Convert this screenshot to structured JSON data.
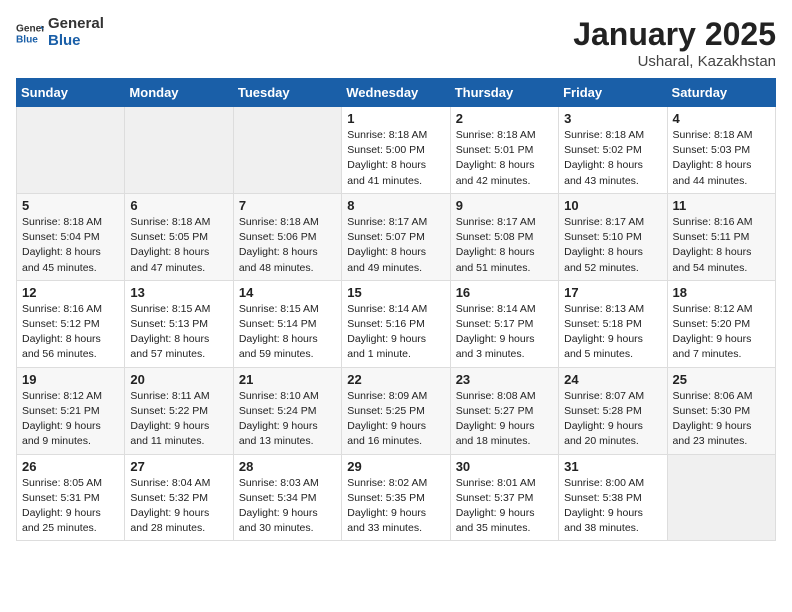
{
  "logo": {
    "general": "General",
    "blue": "Blue"
  },
  "header": {
    "month": "January 2025",
    "location": "Usharal, Kazakhstan"
  },
  "days_of_week": [
    "Sunday",
    "Monday",
    "Tuesday",
    "Wednesday",
    "Thursday",
    "Friday",
    "Saturday"
  ],
  "weeks": [
    [
      {
        "day": "",
        "empty": true
      },
      {
        "day": "",
        "empty": true
      },
      {
        "day": "",
        "empty": true
      },
      {
        "day": "1",
        "sunrise": "8:18 AM",
        "sunset": "5:00 PM",
        "daylight": "8 hours and 41 minutes."
      },
      {
        "day": "2",
        "sunrise": "8:18 AM",
        "sunset": "5:01 PM",
        "daylight": "8 hours and 42 minutes."
      },
      {
        "day": "3",
        "sunrise": "8:18 AM",
        "sunset": "5:02 PM",
        "daylight": "8 hours and 43 minutes."
      },
      {
        "day": "4",
        "sunrise": "8:18 AM",
        "sunset": "5:03 PM",
        "daylight": "8 hours and 44 minutes."
      }
    ],
    [
      {
        "day": "5",
        "sunrise": "8:18 AM",
        "sunset": "5:04 PM",
        "daylight": "8 hours and 45 minutes."
      },
      {
        "day": "6",
        "sunrise": "8:18 AM",
        "sunset": "5:05 PM",
        "daylight": "8 hours and 47 minutes."
      },
      {
        "day": "7",
        "sunrise": "8:18 AM",
        "sunset": "5:06 PM",
        "daylight": "8 hours and 48 minutes."
      },
      {
        "day": "8",
        "sunrise": "8:17 AM",
        "sunset": "5:07 PM",
        "daylight": "8 hours and 49 minutes."
      },
      {
        "day": "9",
        "sunrise": "8:17 AM",
        "sunset": "5:08 PM",
        "daylight": "8 hours and 51 minutes."
      },
      {
        "day": "10",
        "sunrise": "8:17 AM",
        "sunset": "5:10 PM",
        "daylight": "8 hours and 52 minutes."
      },
      {
        "day": "11",
        "sunrise": "8:16 AM",
        "sunset": "5:11 PM",
        "daylight": "8 hours and 54 minutes."
      }
    ],
    [
      {
        "day": "12",
        "sunrise": "8:16 AM",
        "sunset": "5:12 PM",
        "daylight": "8 hours and 56 minutes."
      },
      {
        "day": "13",
        "sunrise": "8:15 AM",
        "sunset": "5:13 PM",
        "daylight": "8 hours and 57 minutes."
      },
      {
        "day": "14",
        "sunrise": "8:15 AM",
        "sunset": "5:14 PM",
        "daylight": "8 hours and 59 minutes."
      },
      {
        "day": "15",
        "sunrise": "8:14 AM",
        "sunset": "5:16 PM",
        "daylight": "9 hours and 1 minute."
      },
      {
        "day": "16",
        "sunrise": "8:14 AM",
        "sunset": "5:17 PM",
        "daylight": "9 hours and 3 minutes."
      },
      {
        "day": "17",
        "sunrise": "8:13 AM",
        "sunset": "5:18 PM",
        "daylight": "9 hours and 5 minutes."
      },
      {
        "day": "18",
        "sunrise": "8:12 AM",
        "sunset": "5:20 PM",
        "daylight": "9 hours and 7 minutes."
      }
    ],
    [
      {
        "day": "19",
        "sunrise": "8:12 AM",
        "sunset": "5:21 PM",
        "daylight": "9 hours and 9 minutes."
      },
      {
        "day": "20",
        "sunrise": "8:11 AM",
        "sunset": "5:22 PM",
        "daylight": "9 hours and 11 minutes."
      },
      {
        "day": "21",
        "sunrise": "8:10 AM",
        "sunset": "5:24 PM",
        "daylight": "9 hours and 13 minutes."
      },
      {
        "day": "22",
        "sunrise": "8:09 AM",
        "sunset": "5:25 PM",
        "daylight": "9 hours and 16 minutes."
      },
      {
        "day": "23",
        "sunrise": "8:08 AM",
        "sunset": "5:27 PM",
        "daylight": "9 hours and 18 minutes."
      },
      {
        "day": "24",
        "sunrise": "8:07 AM",
        "sunset": "5:28 PM",
        "daylight": "9 hours and 20 minutes."
      },
      {
        "day": "25",
        "sunrise": "8:06 AM",
        "sunset": "5:30 PM",
        "daylight": "9 hours and 23 minutes."
      }
    ],
    [
      {
        "day": "26",
        "sunrise": "8:05 AM",
        "sunset": "5:31 PM",
        "daylight": "9 hours and 25 minutes."
      },
      {
        "day": "27",
        "sunrise": "8:04 AM",
        "sunset": "5:32 PM",
        "daylight": "9 hours and 28 minutes."
      },
      {
        "day": "28",
        "sunrise": "8:03 AM",
        "sunset": "5:34 PM",
        "daylight": "9 hours and 30 minutes."
      },
      {
        "day": "29",
        "sunrise": "8:02 AM",
        "sunset": "5:35 PM",
        "daylight": "9 hours and 33 minutes."
      },
      {
        "day": "30",
        "sunrise": "8:01 AM",
        "sunset": "5:37 PM",
        "daylight": "9 hours and 35 minutes."
      },
      {
        "day": "31",
        "sunrise": "8:00 AM",
        "sunset": "5:38 PM",
        "daylight": "9 hours and 38 minutes."
      },
      {
        "day": "",
        "empty": true
      }
    ]
  ]
}
